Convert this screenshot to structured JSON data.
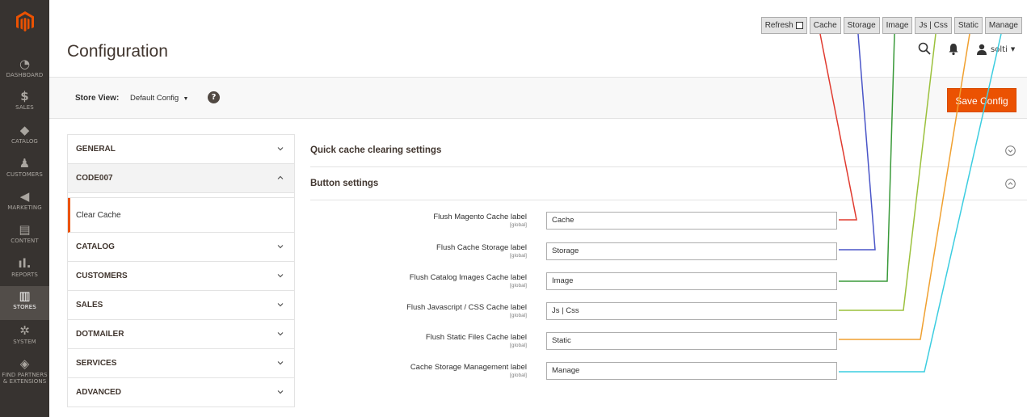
{
  "nav": {
    "items": [
      {
        "label": "DASHBOARD",
        "icon": "dashboard-icon",
        "glyph": "◔"
      },
      {
        "label": "SALES",
        "icon": "dollar-icon",
        "glyph": "$"
      },
      {
        "label": "CATALOG",
        "icon": "cube-icon",
        "glyph": "◆"
      },
      {
        "label": "CUSTOMERS",
        "icon": "person-icon",
        "glyph": "♟"
      },
      {
        "label": "MARKETING",
        "icon": "megaphone-icon",
        "glyph": "◀"
      },
      {
        "label": "CONTENT",
        "icon": "content-icon",
        "glyph": "▤"
      },
      {
        "label": "REPORTS",
        "icon": "bar-chart-icon",
        "glyph": "ıl."
      },
      {
        "label": "STORES",
        "icon": "store-icon",
        "glyph": "▥"
      },
      {
        "label": "SYSTEM",
        "icon": "gear-icon",
        "glyph": "✲"
      },
      {
        "label1": "FIND PARTNERS",
        "label2": "& EXTENSIONS",
        "icon": "partners-icon",
        "glyph": "◈"
      }
    ]
  },
  "header": {
    "title": "Configuration",
    "user": "solti"
  },
  "quick_buttons": {
    "refresh": "Refresh",
    "cache": "Cache",
    "storage": "Storage",
    "image": "Image",
    "jscss": "Js | Css",
    "static": "Static",
    "manage": "Manage"
  },
  "store_bar": {
    "label": "Store View:",
    "value": "Default Config",
    "save": "Save Config"
  },
  "tabs": {
    "general": "GENERAL",
    "code007": "CODE007",
    "clear_cache": "Clear Cache",
    "catalog": "CATALOG",
    "customers": "CUSTOMERS",
    "sales": "SALES",
    "dotmailer": "DOTMAILER",
    "services": "SERVICES",
    "advanced": "ADVANCED"
  },
  "sections": {
    "quick": "Quick cache clearing settings",
    "buttons": "Button settings"
  },
  "fields": [
    {
      "label": "Flush Magento Cache label",
      "scope": "[global]",
      "value": "Cache"
    },
    {
      "label": "Flush Cache Storage label",
      "scope": "[global]",
      "value": "Storage"
    },
    {
      "label": "Flush Catalog Images Cache label",
      "scope": "[global]",
      "value": "Image"
    },
    {
      "label": "Flush Javascript / CSS Cache label",
      "scope": "[global]",
      "value": "Js | Css"
    },
    {
      "label": "Flush Static Files Cache label",
      "scope": "[global]",
      "value": "Static"
    },
    {
      "label": "Cache Storage Management label",
      "scope": "[global]",
      "value": "Manage"
    }
  ],
  "colors": {
    "accent": "#eb5202",
    "nav_bg": "#373330",
    "cache_line": "#e03a2f",
    "storage_line": "#4a55c8",
    "image_line": "#3a9a3a",
    "jscss_line": "#9bc13c",
    "static_line": "#f0a030",
    "manage_line": "#3ccde0"
  }
}
